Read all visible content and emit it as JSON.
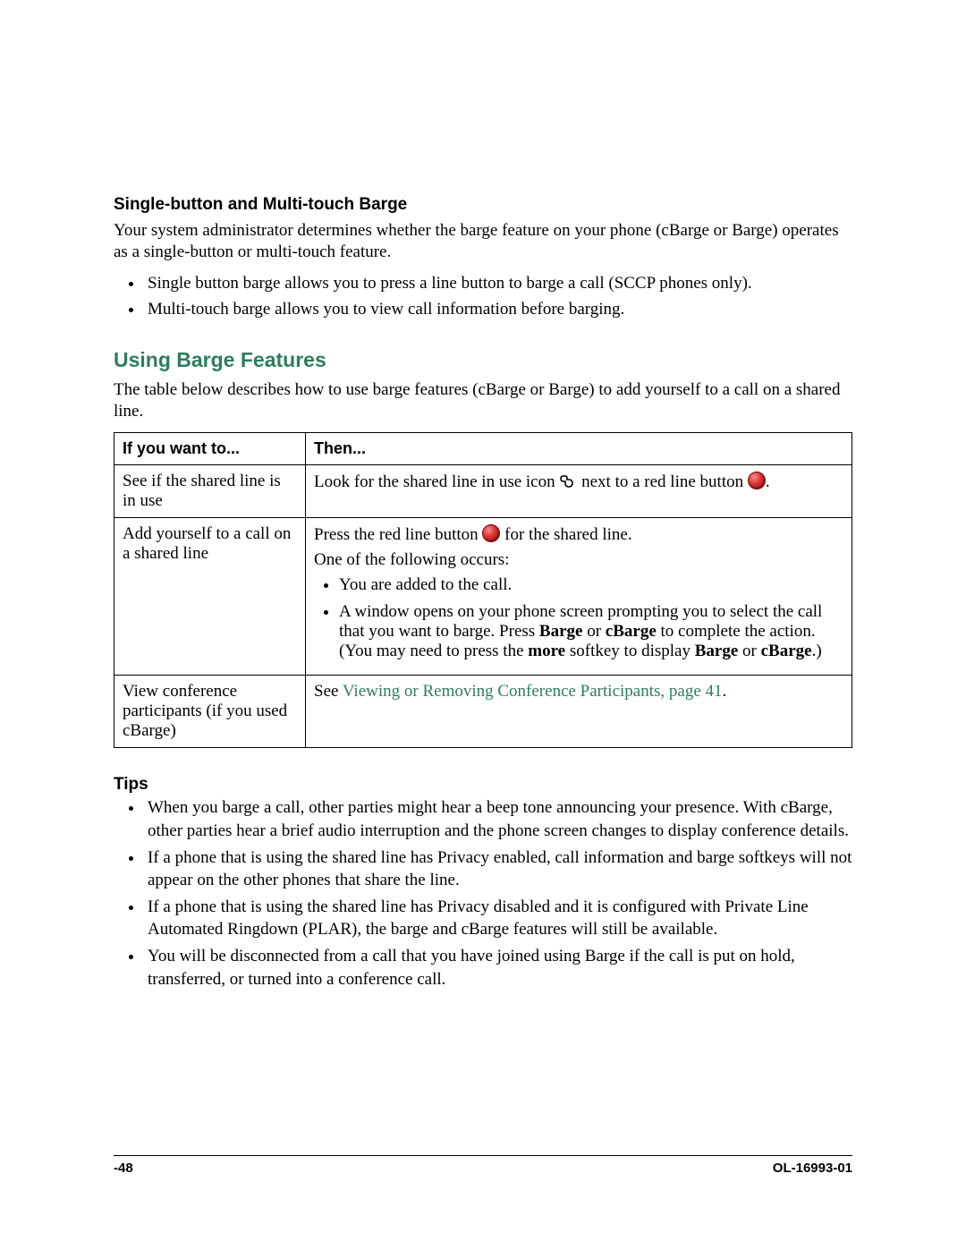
{
  "section1": {
    "title": "Single-button and Multi-touch Barge",
    "intro": "Your system administrator determines whether the barge feature on your phone (cBarge or Barge) operates as a single-button or multi-touch feature.",
    "bullets": [
      "Single button barge allows you to press a line button to barge a call (SCCP phones only).",
      "Multi-touch barge allows you to view call information before barging."
    ]
  },
  "section2": {
    "title": "Using Barge Features",
    "intro": "The table below describes how to use barge features (cBarge or Barge) to add yourself to a call on a shared line.",
    "th1": "If you want to...",
    "th2": "Then...",
    "row1": {
      "c1": "See if the shared line is in use",
      "c2_pre": "Look for the shared line in use icon ",
      "c2_mid": " next to a red line button ",
      "c2_end": "."
    },
    "row2": {
      "c1": "Add yourself to a call on a shared line",
      "line1_pre": "Press the red line button ",
      "line1_post": " for the shared line.",
      "line2": "One of the following occurs:",
      "b1": "You are added to the call.",
      "b2_pre": "A window opens on your phone screen prompting you to select the call that you want to barge. Press ",
      "b2_bold1": "Barge",
      "b2_or": " or ",
      "b2_bold2": "cBarge",
      "b2_mid": " to complete the action. (You may need to press the ",
      "b2_bold3": "more",
      "b2_mid2": " softkey to display ",
      "b2_bold4": "Barge",
      "b2_or2": " or ",
      "b2_bold5": "cBarge",
      "b2_end": ".)"
    },
    "row3": {
      "c1": "View conference participants (if you used cBarge)",
      "c2_pre": "See ",
      "c2_link": "Viewing or Removing Conference Participants, page 41",
      "c2_end": "."
    }
  },
  "tips": {
    "title": "Tips",
    "bullets": [
      "When you barge a call, other parties might hear a beep tone announcing your presence. With cBarge, other parties hear a brief audio interruption and the phone screen changes to display conference details.",
      "If a phone that is using the shared line has Privacy enabled, call information and barge softkeys will not appear on the other phones that share the line.",
      "If a phone that is using the shared line has Privacy disabled and it is configured with Private Line Automated Ringdown (PLAR), the barge and cBarge features will still be available.",
      "You will be disconnected from a call that you have joined using Barge if the call is put on hold, transferred, or turned into a conference call."
    ]
  },
  "footer": {
    "left": "-48",
    "right": "OL-16993-01"
  }
}
